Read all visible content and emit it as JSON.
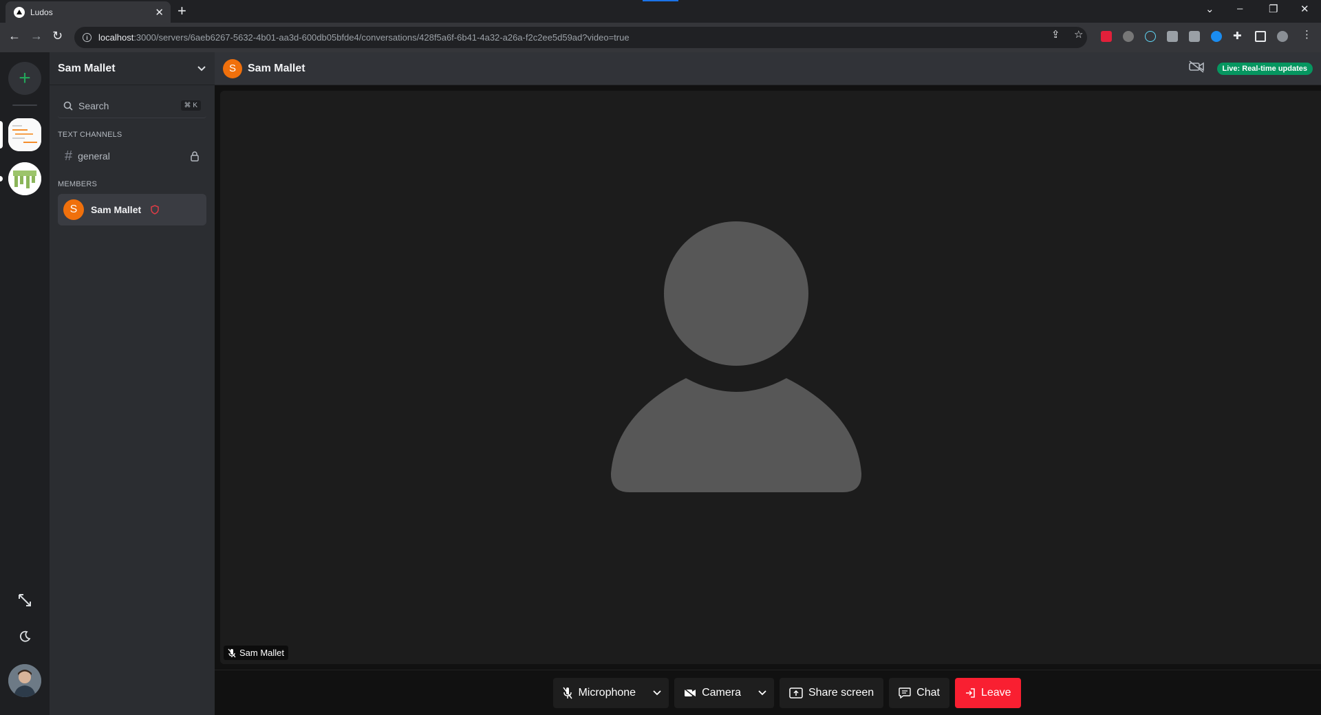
{
  "browser": {
    "tab_title": "Ludos",
    "tab_close": "✕",
    "new_tab": "+",
    "url_host": "localhost",
    "url_path": ":3000/servers/6aeb6267-5632-4b01-aa3d-600db05bfde4/conversations/428f5a6f-6b41-4a32-a26a-f2c2ee5d59ad?video=true",
    "extensions": [
      "ABP",
      "lightbulb",
      "react",
      "ext",
      "ext",
      "shazam",
      "puzzle",
      "sidepanel",
      "profile"
    ]
  },
  "server": {
    "name": "Sam Mallet",
    "search_label": "Search",
    "search_shortcut": "⌘ K"
  },
  "sections": {
    "text_channels": "TEXT CHANNELS",
    "members": "MEMBERS"
  },
  "channels": [
    {
      "name": "general",
      "locked": true
    }
  ],
  "members": [
    {
      "initial": "S",
      "name": "Sam Mallet",
      "role_icon": "shield-icon"
    }
  ],
  "conversation": {
    "initial": "S",
    "title": "Sam Mallet",
    "live_badge": "Live: Real-time updates"
  },
  "video": {
    "participant_name": "Sam Mallet"
  },
  "controls": {
    "microphone": "Microphone",
    "camera": "Camera",
    "share_screen": "Share screen",
    "chat": "Chat",
    "leave": "Leave"
  },
  "colors": {
    "accent_green": "#23a55a",
    "live_green": "#069660",
    "avatar_orange": "#f0700c",
    "leave_red": "#f91f31",
    "shield_red": "#e03c46"
  }
}
